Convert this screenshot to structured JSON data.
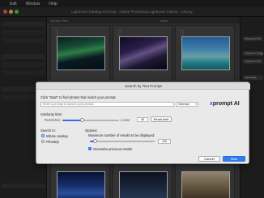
{
  "menubar": {
    "items": [
      "Edit",
      "Window",
      "Help"
    ]
  },
  "window": {
    "title": "Lightroom Catalog-v13.lrcat - Adobe Photoshop Lightroom Classic - Library"
  },
  "grid": {
    "header_left": "Library Filter",
    "header_right": "None",
    "cell_numbers": [
      "1",
      "2",
      "3"
    ]
  },
  "right_panel": {
    "buttons": [
      "Keyword Set",
      "Keyword Sugg",
      "Keyword Set",
      "Metadata"
    ]
  },
  "dialog": {
    "title": "Search by Text Prompt",
    "instruction": "Click \"Start\" to find photos that match your prompt.",
    "search_placeholder": "Enter a prompt to search your photos",
    "language": "German",
    "brand_prefix": "x",
    "brand_name": "prompt AI",
    "similarity_label": "Similarity limit:",
    "restrictive_label": "Restrictive",
    "loose_label": "Loose",
    "similarity_value": "40",
    "reset_label": "Reset limit",
    "search_in_label": "Search in:",
    "radio_whole": "Whole catalog",
    "radio_filmstrip": "Filmstrip",
    "options_label": "Options:",
    "max_results_label": "Maximum number of results to be displayed:",
    "max_results_value": "100",
    "overwrite_label": "Overwrite previous results",
    "cancel_label": "Cancel",
    "start_label": "Start",
    "similarity_level": 0.35,
    "max_results_level": 0.08
  },
  "colors": {
    "accent": "#2f7df0",
    "brand_x": "#2d6ac8"
  }
}
